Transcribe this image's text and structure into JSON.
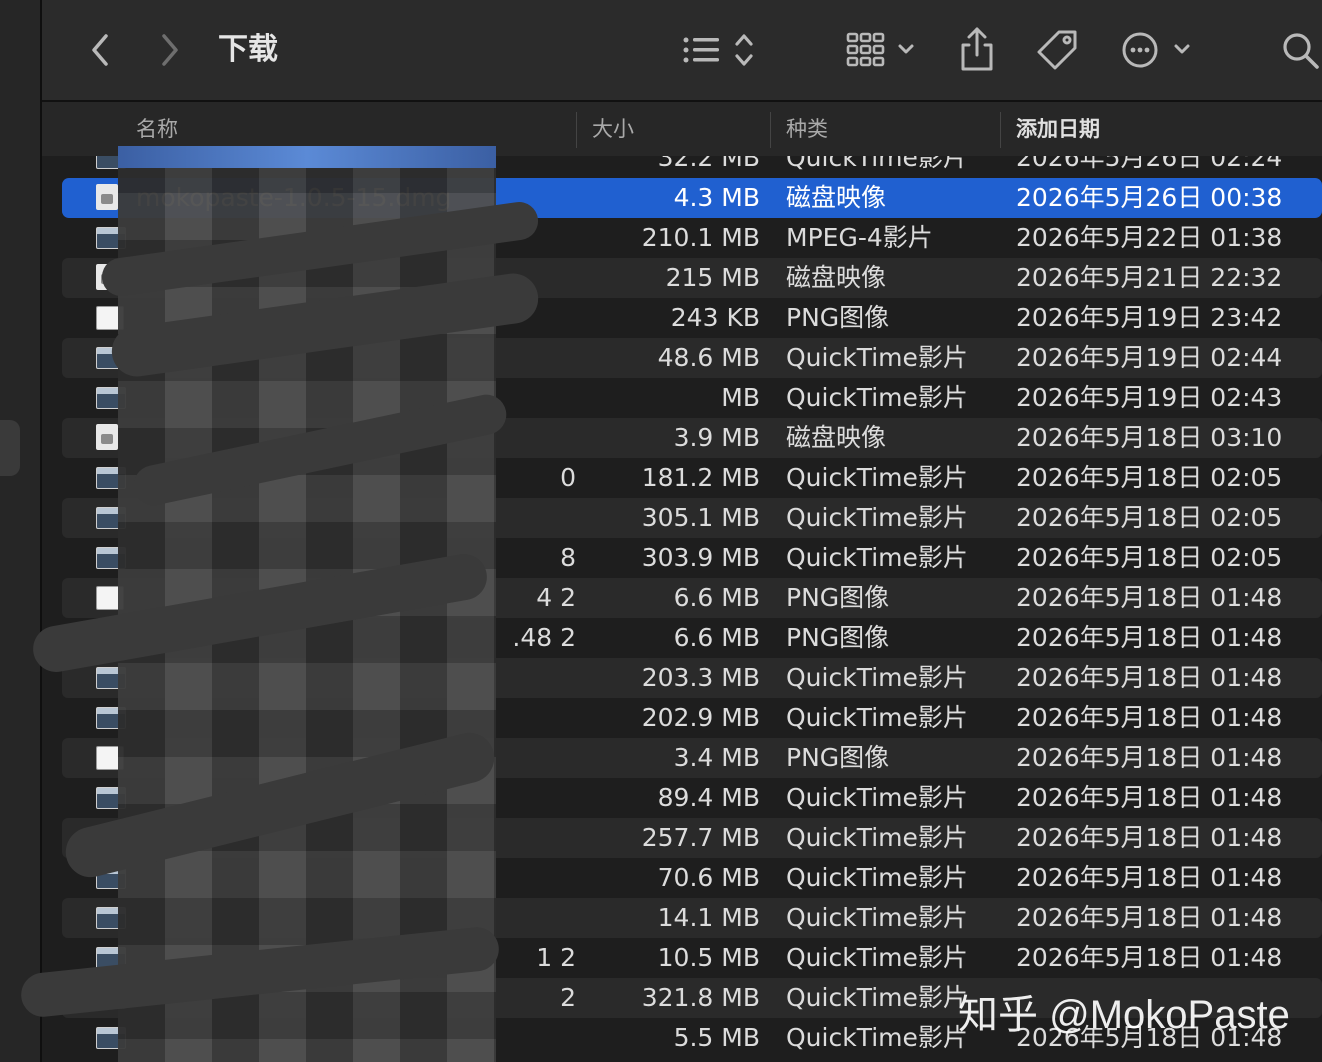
{
  "window": {
    "title": "下载"
  },
  "toolbar": {
    "icons": [
      "chevron-left-icon",
      "chevron-right-icon",
      "list-view-icon",
      "grid-view-icon",
      "share-icon",
      "tag-icon",
      "more-icon",
      "search-icon"
    ]
  },
  "columns": {
    "name": "名称",
    "size": "大小",
    "kind": "种类",
    "date": "添加日期"
  },
  "files": [
    {
      "name": "",
      "size": "32.2 MB",
      "kind": "QuickTime影片",
      "date": "2026年5月26日 02:24",
      "icon": "movie"
    },
    {
      "name": "mokopaste-1.0.5-15.dmg",
      "size": "4.3 MB",
      "kind": "磁盘映像",
      "date": "2026年5月26日 00:38",
      "icon": "dmg",
      "selected": true
    },
    {
      "name": "",
      "size": "210.1 MB",
      "kind": "MPEG-4影片",
      "date": "2026年5月22日 01:38",
      "icon": "movie"
    },
    {
      "name": "",
      "size": "215 MB",
      "kind": "磁盘映像",
      "date": "2026年5月21日 22:32",
      "icon": "dmg"
    },
    {
      "name": "",
      "size": "243 KB",
      "kind": "PNG图像",
      "date": "2026年5月19日 23:42",
      "icon": "png"
    },
    {
      "name": "",
      "size": "48.6 MB",
      "kind": "QuickTime影片",
      "date": "2026年5月19日 02:44",
      "icon": "movie"
    },
    {
      "name": "",
      "size": "MB",
      "kind": "QuickTime影片",
      "date": "2026年5月19日 02:43",
      "icon": "movie"
    },
    {
      "name": "",
      "size": "3.9 MB",
      "kind": "磁盘映像",
      "date": "2026年5月18日 03:10",
      "icon": "dmg"
    },
    {
      "name": "0",
      "size": "181.2 MB",
      "kind": "QuickTime影片",
      "date": "2026年5月18日 02:05",
      "icon": "movie"
    },
    {
      "name": "",
      "size": "305.1 MB",
      "kind": "QuickTime影片",
      "date": "2026年5月18日 02:05",
      "icon": "movie"
    },
    {
      "name": "8",
      "size": "303.9 MB",
      "kind": "QuickTime影片",
      "date": "2026年5月18日 02:05",
      "icon": "movie"
    },
    {
      "name": "4 2",
      "size": "6.6 MB",
      "kind": "PNG图像",
      "date": "2026年5月18日 01:48",
      "icon": "png"
    },
    {
      "name": ".48 2",
      "size": "6.6 MB",
      "kind": "PNG图像",
      "date": "2026年5月18日 01:48",
      "icon": "png"
    },
    {
      "name": "",
      "size": "203.3 MB",
      "kind": "QuickTime影片",
      "date": "2026年5月18日 01:48",
      "icon": "movie"
    },
    {
      "name": "",
      "size": "202.9 MB",
      "kind": "QuickTime影片",
      "date": "2026年5月18日 01:48",
      "icon": "movie"
    },
    {
      "name": "",
      "size": "3.4 MB",
      "kind": "PNG图像",
      "date": "2026年5月18日 01:48",
      "icon": "png"
    },
    {
      "name": "",
      "size": "89.4 MB",
      "kind": "QuickTime影片",
      "date": "2026年5月18日 01:48",
      "icon": "movie"
    },
    {
      "name": "",
      "size": "257.7 MB",
      "kind": "QuickTime影片",
      "date": "2026年5月18日 01:48",
      "icon": "movie"
    },
    {
      "name": "",
      "size": "70.6 MB",
      "kind": "QuickTime影片",
      "date": "2026年5月18日 01:48",
      "icon": "movie"
    },
    {
      "name": "",
      "size": "14.1 MB",
      "kind": "QuickTime影片",
      "date": "2026年5月18日 01:48",
      "icon": "movie"
    },
    {
      "name": "1 2",
      "size": "10.5 MB",
      "kind": "QuickTime影片",
      "date": "2026年5月18日 01:48",
      "icon": "movie"
    },
    {
      "name": "2",
      "size": "321.8 MB",
      "kind": "QuickTime影片",
      "date": "",
      "icon": "movie"
    },
    {
      "name": "",
      "size": "5.5 MB",
      "kind": "QuickTime影片",
      "date": "2026年5月18日 01:48",
      "icon": "movie"
    }
  ],
  "watermark": {
    "text": "知乎 @MokoPaste"
  },
  "colors": {
    "selection": "#2060d0",
    "background": "#1e1e1e",
    "toolbar": "#2b2b2b"
  }
}
